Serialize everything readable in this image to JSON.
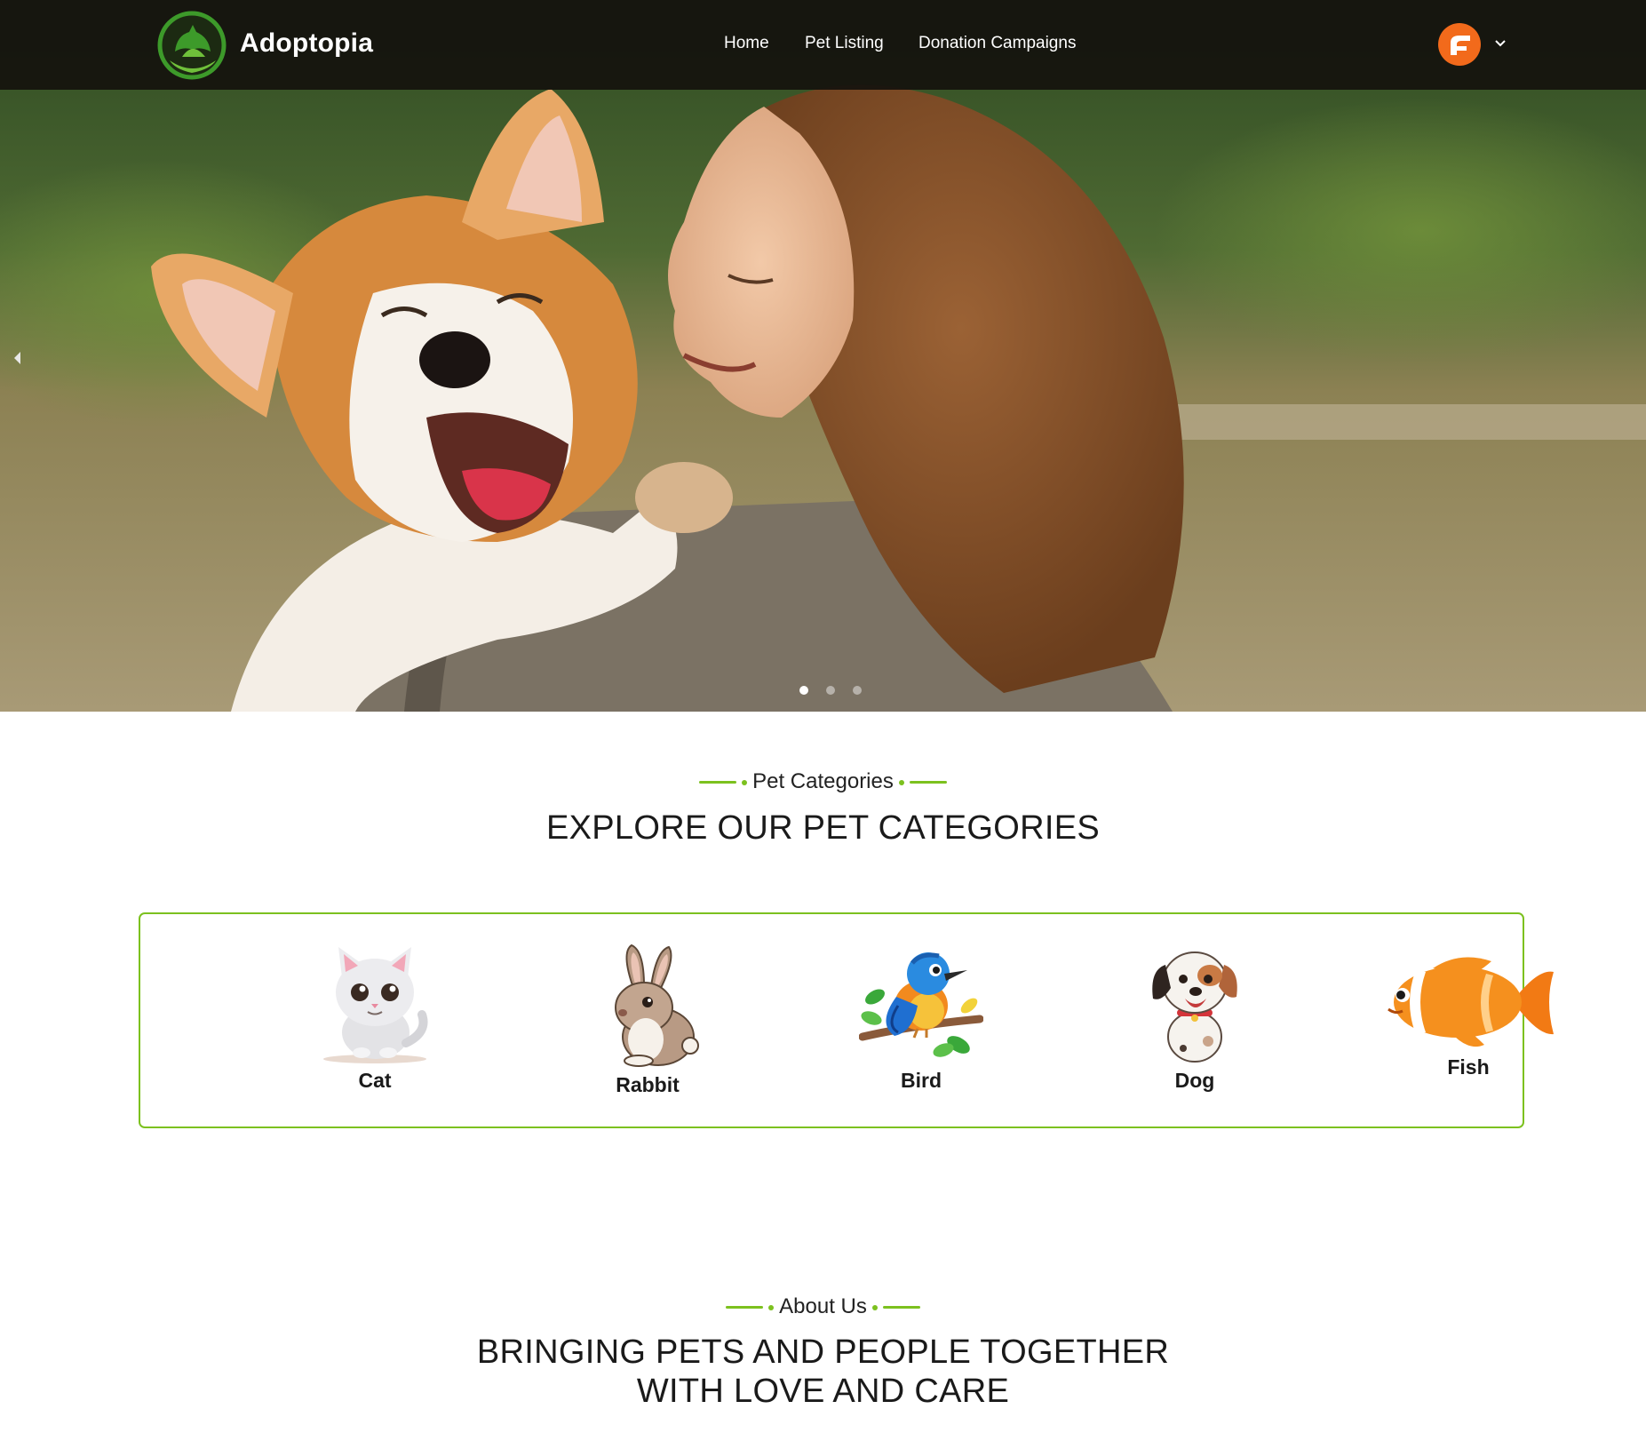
{
  "header": {
    "brand": "Adoptopia",
    "nav": [
      {
        "label": "Home"
      },
      {
        "label": "Pet Listing"
      },
      {
        "label": "Donation Campaigns"
      }
    ]
  },
  "hero": {
    "slide_count": 3,
    "active_slide": 1
  },
  "categories_section": {
    "eyebrow": "Pet Categories",
    "title": "EXPLORE OUR PET CATEGORIES",
    "items": [
      {
        "label": "Cat",
        "icon": "cat-icon"
      },
      {
        "label": "Rabbit",
        "icon": "rabbit-icon"
      },
      {
        "label": "Bird",
        "icon": "bird-icon"
      },
      {
        "label": "Dog",
        "icon": "dog-icon"
      },
      {
        "label": "Fish",
        "icon": "fish-icon"
      }
    ]
  },
  "about_section": {
    "eyebrow": "About Us",
    "title_line1": "BRINGING PETS AND PEOPLE TOGETHER",
    "title_line2": "WITH LOVE AND CARE"
  },
  "colors": {
    "accent": "#7cc11f",
    "navbar": "#14120e",
    "avatar": "#f26a1b",
    "logo_green": "#3d9a2a"
  }
}
